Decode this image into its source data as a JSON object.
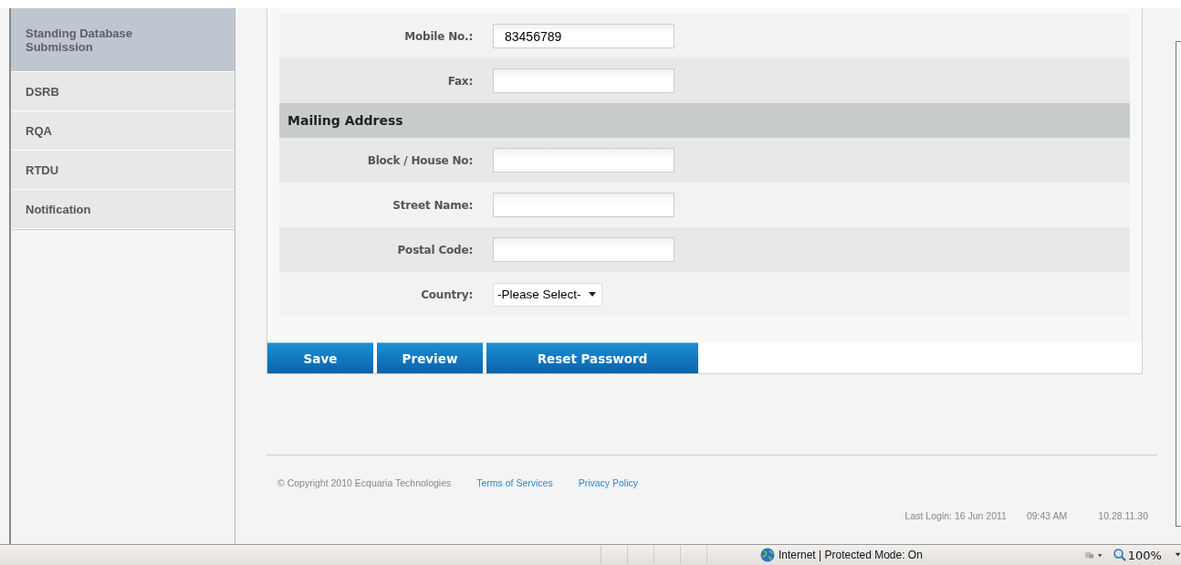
{
  "sidebar": {
    "items": [
      {
        "label": "Standing Database Submission",
        "selected": true
      },
      {
        "label": "DSRB",
        "selected": false
      },
      {
        "label": "RQA",
        "selected": false
      },
      {
        "label": "RTDU",
        "selected": false
      },
      {
        "label": "Notification",
        "selected": false
      }
    ]
  },
  "form": {
    "rows": [
      {
        "kind": "field",
        "label": "Mobile No.:",
        "value": "83456789"
      },
      {
        "kind": "field",
        "label": "Fax:"
      },
      {
        "kind": "section",
        "label": "Mailing Address"
      },
      {
        "kind": "field",
        "label": "Block / House No:"
      },
      {
        "kind": "field",
        "label": "Street Name:"
      },
      {
        "kind": "field",
        "label": "Postal Code:"
      },
      {
        "kind": "select",
        "label": "Country:",
        "value": "-Please Select-"
      }
    ]
  },
  "buttons": [
    "Save",
    "Preview",
    "Reset Password"
  ],
  "footer": {
    "copyright": "© Copyright 2010 Ecquaria Technologies",
    "links": [
      "Terms of Services",
      "Privacy Policy"
    ],
    "last_login": "Last Login: 16 Jun 2011",
    "time": "09:43 AM",
    "ip": "10.28.11.30"
  },
  "status_bar": {
    "zone": "Internet | Protected Mode: On",
    "zoom": "100%"
  }
}
